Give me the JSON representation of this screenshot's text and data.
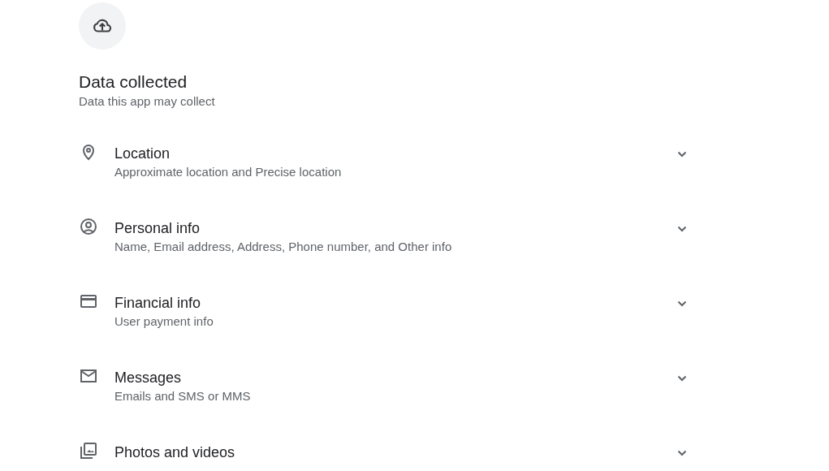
{
  "section": {
    "title": "Data collected",
    "subtitle": "Data this app may collect"
  },
  "items": [
    {
      "kind": "location",
      "title": "Location",
      "detail": "Approximate location and Precise location",
      "expanded": false
    },
    {
      "kind": "person",
      "title": "Personal info",
      "detail": "Name, Email address, Address, Phone number, and Other info",
      "expanded": false
    },
    {
      "kind": "card",
      "title": "Financial info",
      "detail": "User payment info",
      "expanded": false
    },
    {
      "kind": "mail",
      "title": "Messages",
      "detail": "Emails and SMS or MMS",
      "expanded": false
    },
    {
      "kind": "photos",
      "title": "Photos and videos",
      "expanded": false
    }
  ]
}
